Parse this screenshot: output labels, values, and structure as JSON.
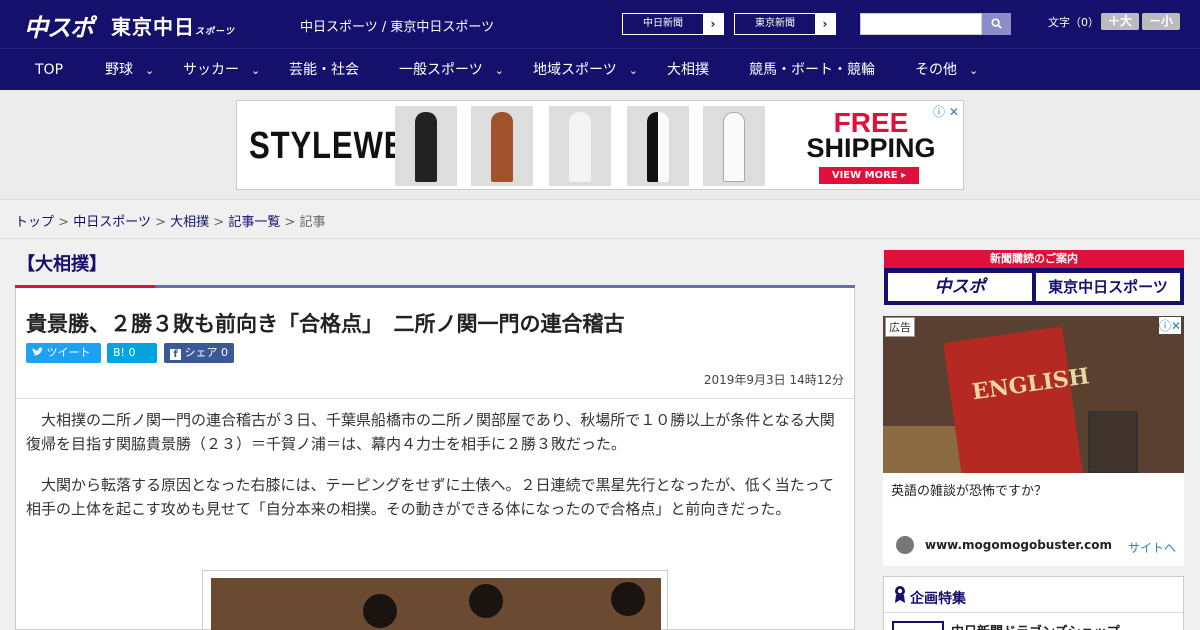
{
  "header": {
    "logo_main": "中スポ",
    "logo_tokyo": "東京中日",
    "logo_tokyo_sub": "スポーツ",
    "site_title": "中日スポーツ / 東京中日スポーツ",
    "btn_chunichi": "中日新聞",
    "btn_tokyo": "東京新聞",
    "btn_arrow": "›",
    "search_icon": "search-icon",
    "font_label": "文字（0）",
    "font_bigger": "＋大",
    "font_smaller": "－小"
  },
  "nav": {
    "items": [
      "TOP",
      "野球",
      "サッカー",
      "芸能・社会",
      "一般スポーツ",
      "地域スポーツ",
      "大相撲",
      "競馬・ボート・競輪",
      "その他"
    ],
    "chevron": "⌄"
  },
  "banner_ad": {
    "brand": "STYLEWE",
    "free": "FREE",
    "shipping": "SHIPPING",
    "cta": "VIEW MORE ▸",
    "info": "ⓘ ✕"
  },
  "breadcrumb": {
    "items": [
      "トップ",
      "中日スポーツ",
      "大相撲",
      "記事一覧"
    ],
    "current": "記事",
    "sep": ">"
  },
  "article": {
    "category": "【大相撲】",
    "headline": "貴景勝、２勝３敗も前向き「合格点」　二所ノ関一門の連合稽古",
    "share_twitter": "ツイート",
    "share_hatena": "B! 0",
    "share_facebook": "シェア 0",
    "date": "2019年9月3日 14時12分",
    "paragraphs": [
      "大相撲の二所ノ関一門の連合稽古が３日、千葉県船橋市の二所ノ関部屋であり、秋場所で１０勝以上が条件となる大関復帰を目指す関脇貴景勝（２３）＝千賀ノ浦＝は、幕内４力士を相手に２勝３敗だった。",
      "大関から転落する原因となった右膝には、テーピングをせずに土俵へ。２日連続で黒星先行となったが、低く当たって相手の上体を起こす攻めも見せて「自分本来の相撲。その動きができる体になったので合格点」と前向きだった。"
    ]
  },
  "sidebar": {
    "subscribe_head": "新聞購読のご案内",
    "subscribe_logo1": "中スポ",
    "subscribe_logo2": "東京中日スポーツ",
    "ad_tag": "広告",
    "ad_close": "ⓘ✕",
    "ad_book_text": "ENGLISH",
    "ad_copy": "英語の雑談が恐怖ですか？",
    "ad_domain": "www.mogomogobuster.com",
    "ad_link": "サイトへ",
    "feature_title": "企画特集",
    "feature_item": "中日新聞ドラゴンズショップ"
  }
}
